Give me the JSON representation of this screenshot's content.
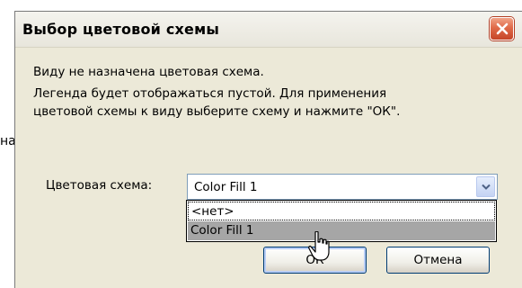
{
  "background": {
    "fragment_text": "на."
  },
  "dialog": {
    "title": "Выбор цветовой схемы",
    "message_lines": [
      "Виду не назначена цветовая схема.",
      "Легенда будет отображаться пустой. Для применения",
      "цветовой схемы к виду выберите схему и нажмите \"ОК\"."
    ],
    "scheme_label": "Цветовая схема:",
    "scheme_value": "Color Fill 1",
    "options": [
      "<нет>",
      "Color Fill 1"
    ],
    "highlighted_option": "Color Fill 1",
    "ok_label": "ОК",
    "cancel_label": "Отмена"
  },
  "colors": {
    "dialog_bg": "#ece9d8",
    "close_button": "#e06a48",
    "highlight": "#a6a6a6",
    "combo_border": "#7f9db9"
  },
  "icons": [
    "close-icon",
    "chevron-down-icon",
    "mouse-cursor-icon"
  ]
}
